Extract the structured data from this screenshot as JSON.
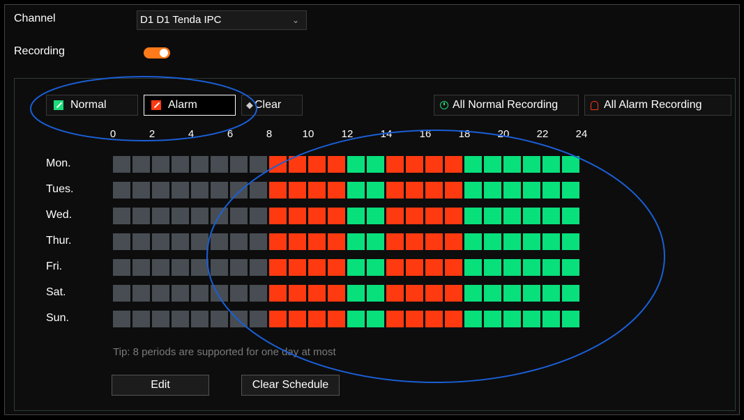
{
  "channel": {
    "label": "Channel",
    "selected": "D1 D1 Tenda IPC"
  },
  "recording": {
    "label": "Recording",
    "enabled": true
  },
  "toolbar": {
    "normal_label": "Normal",
    "alarm_label": "Alarm",
    "clear_label": "Clear",
    "all_normal_label": "All Normal Recording",
    "all_alarm_label": "All Alarm Recording"
  },
  "colors": {
    "off": "#474d53",
    "alarm": "#ff3a10",
    "normal": "#08e07c",
    "toggle": "#ff7a1a",
    "annotation": "#1a5fd6"
  },
  "hours": [
    "0",
    "2",
    "4",
    "6",
    "8",
    "10",
    "12",
    "14",
    "16",
    "18",
    "20",
    "22",
    "24"
  ],
  "days": [
    "Mon.",
    "Tues.",
    "Wed.",
    "Thur.",
    "Fri.",
    "Sat.",
    "Sun."
  ],
  "schedule_pattern": [
    "off",
    "off",
    "off",
    "off",
    "off",
    "off",
    "off",
    "off",
    "alarm",
    "alarm",
    "alarm",
    "alarm",
    "normal",
    "normal",
    "alarm",
    "alarm",
    "alarm",
    "alarm",
    "normal",
    "normal",
    "normal",
    "normal",
    "normal",
    "normal"
  ],
  "tip": "Tip: 8 periods are supported for one day at most",
  "actions": {
    "edit_label": "Edit",
    "clear_schedule_label": "Clear Schedule"
  }
}
